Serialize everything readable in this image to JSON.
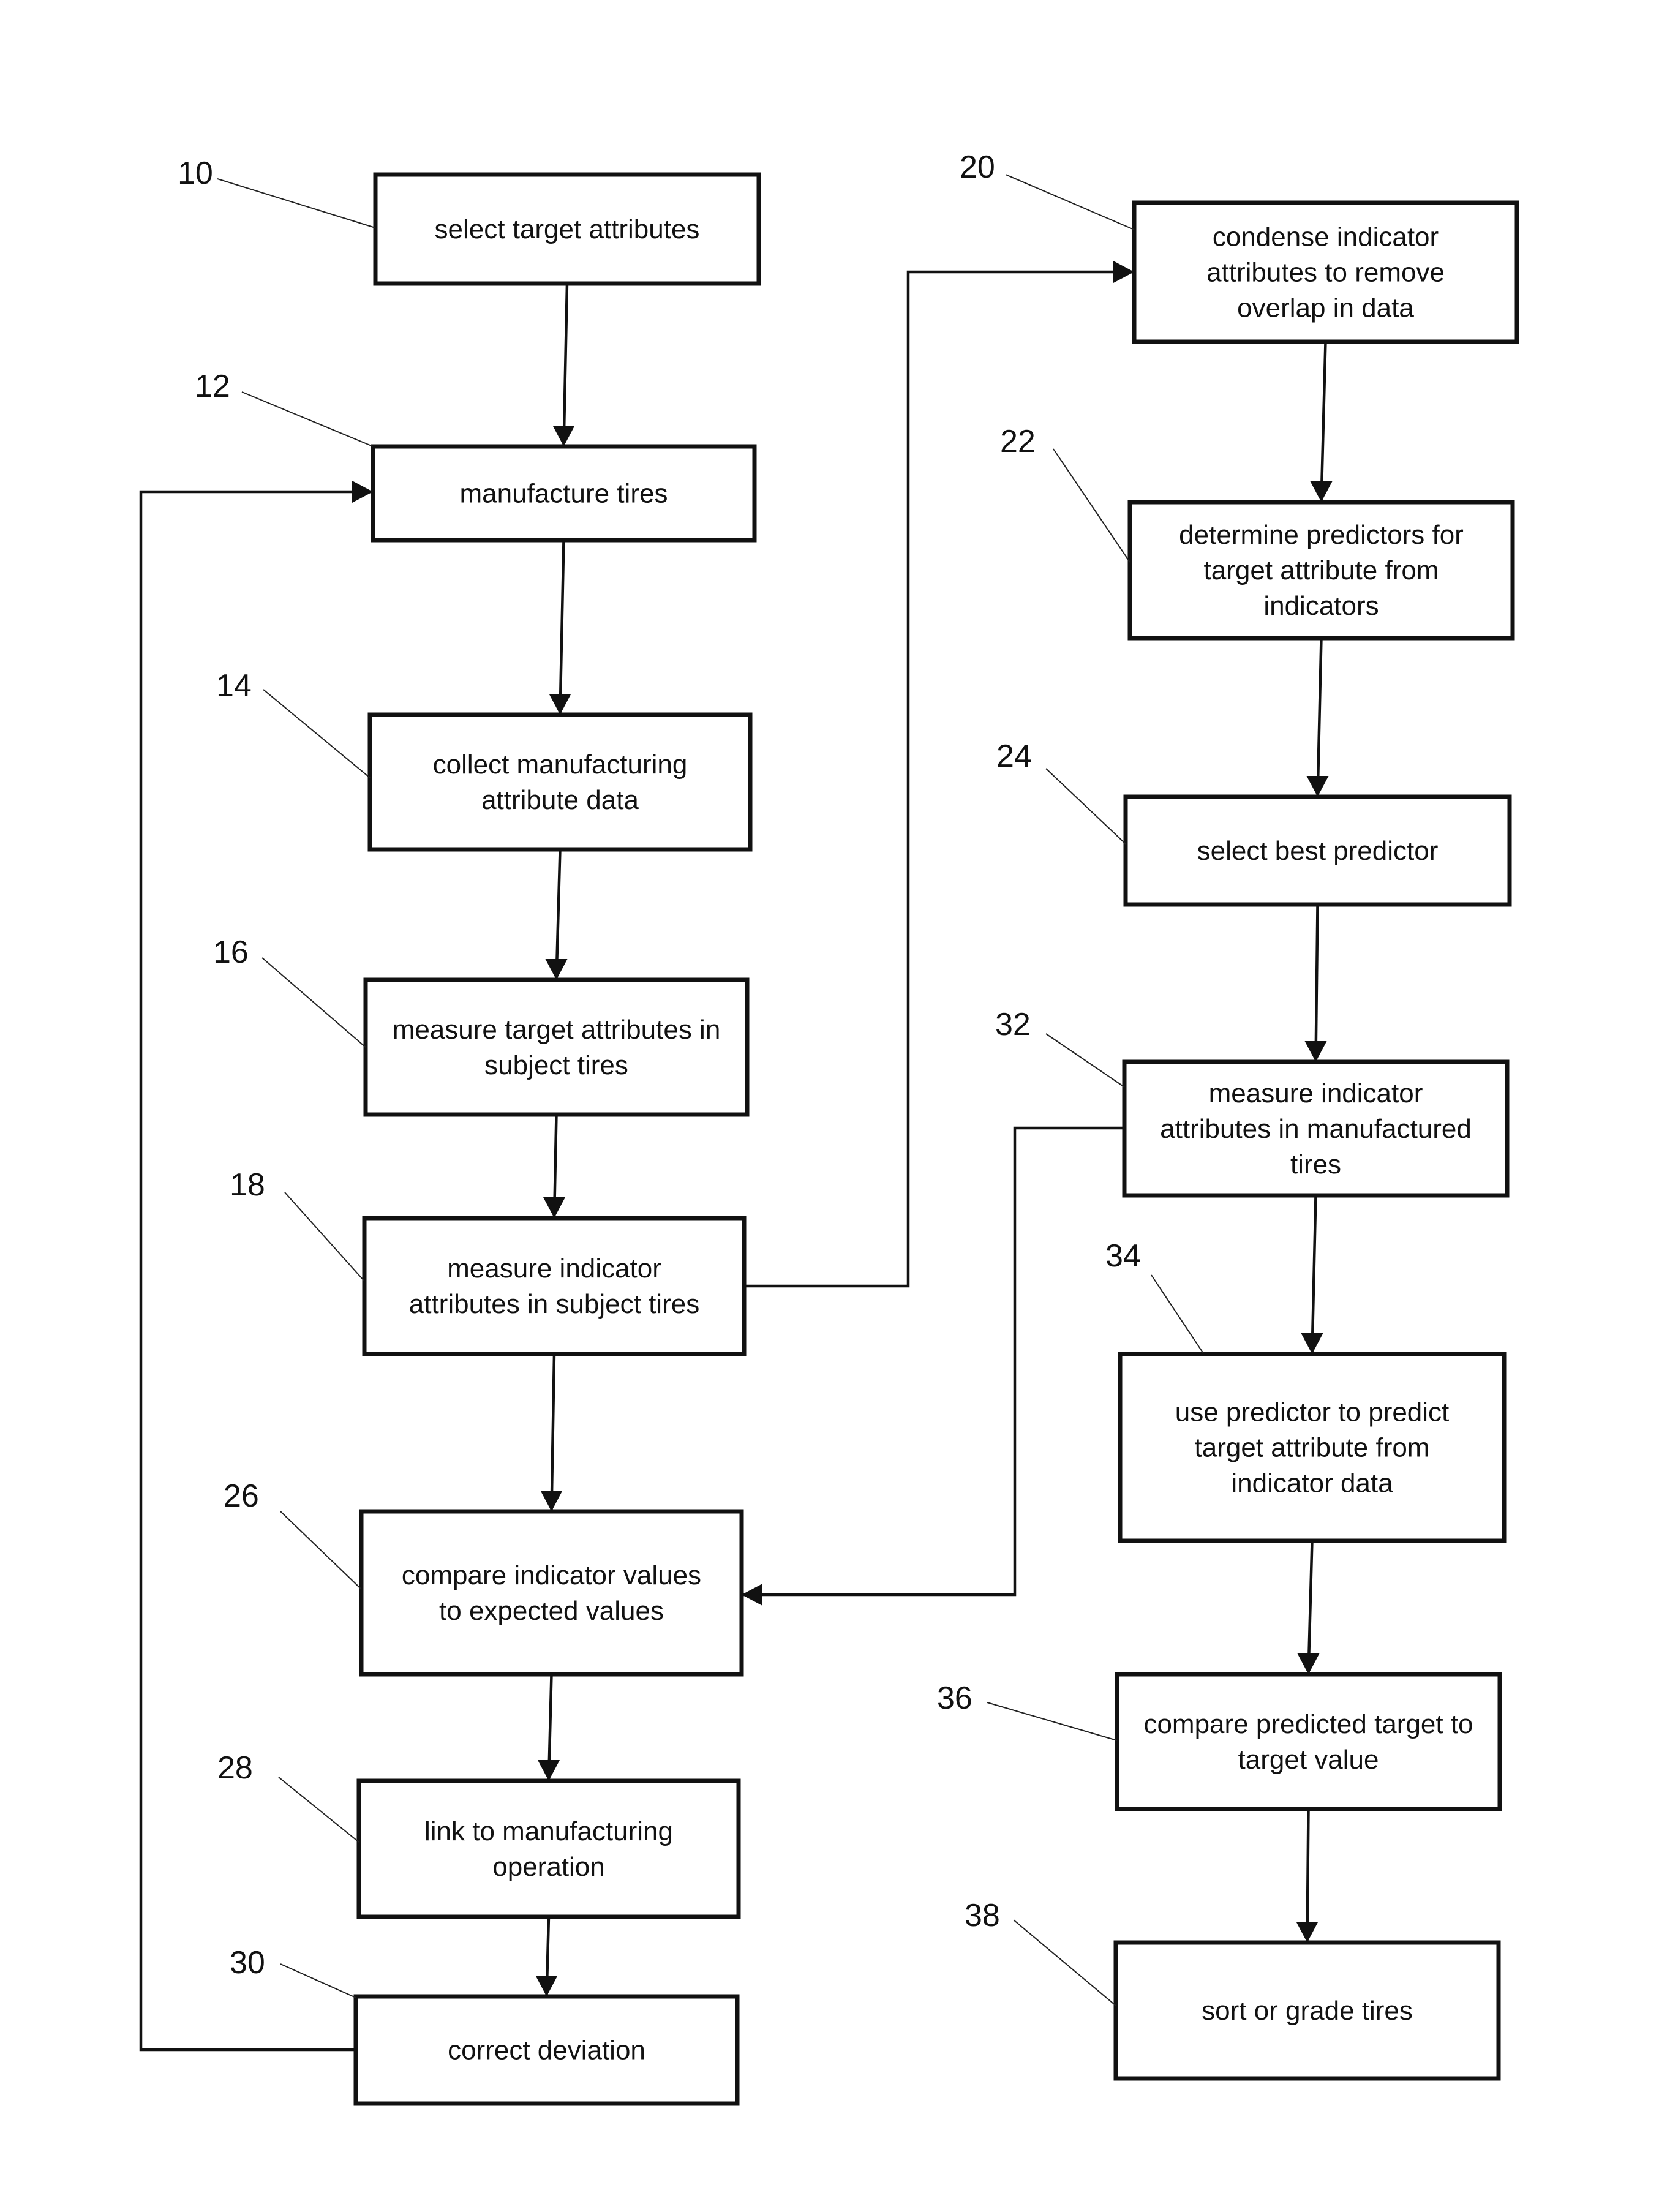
{
  "diagram": {
    "type": "flowchart",
    "nodes": [
      {
        "id": "10",
        "ref": "10",
        "lines": [
          "select target attributes"
        ]
      },
      {
        "id": "12",
        "ref": "12",
        "lines": [
          "manufacture tires"
        ]
      },
      {
        "id": "14",
        "ref": "14",
        "lines": [
          "collect manufacturing",
          "attribute data"
        ]
      },
      {
        "id": "16",
        "ref": "16",
        "lines": [
          "measure target attributes in",
          "subject tires"
        ]
      },
      {
        "id": "18",
        "ref": "18",
        "lines": [
          "measure indicator",
          "attributes in subject tires"
        ]
      },
      {
        "id": "26",
        "ref": "26",
        "lines": [
          "compare indicator values",
          "to expected values"
        ]
      },
      {
        "id": "28",
        "ref": "28",
        "lines": [
          "link to manufacturing",
          "operation"
        ]
      },
      {
        "id": "30",
        "ref": "30",
        "lines": [
          "correct deviation"
        ]
      },
      {
        "id": "20",
        "ref": "20",
        "lines": [
          "condense indicator",
          "attributes to remove",
          "overlap in data"
        ]
      },
      {
        "id": "22",
        "ref": "22",
        "lines": [
          "determine predictors for",
          "target attribute from",
          "indicators"
        ]
      },
      {
        "id": "24",
        "ref": "24",
        "lines": [
          "select best predictor"
        ]
      },
      {
        "id": "32",
        "ref": "32",
        "lines": [
          "measure indicator",
          "attributes in manufactured",
          "tires"
        ]
      },
      {
        "id": "34",
        "ref": "34",
        "lines": [
          "use predictor to predict",
          "target attribute from",
          "indicator data"
        ]
      },
      {
        "id": "36",
        "ref": "36",
        "lines": [
          "compare predicted target to",
          "target value"
        ]
      },
      {
        "id": "38",
        "ref": "38",
        "lines": [
          "sort or grade tires"
        ]
      }
    ],
    "edges": [
      {
        "from": "10",
        "to": "12"
      },
      {
        "from": "12",
        "to": "14"
      },
      {
        "from": "14",
        "to": "16"
      },
      {
        "from": "16",
        "to": "18"
      },
      {
        "from": "18",
        "to": "26"
      },
      {
        "from": "26",
        "to": "28"
      },
      {
        "from": "28",
        "to": "30"
      },
      {
        "from": "30",
        "to": "12",
        "kind": "feedback loop"
      },
      {
        "from": "18",
        "to": "20"
      },
      {
        "from": "20",
        "to": "22"
      },
      {
        "from": "22",
        "to": "24"
      },
      {
        "from": "24",
        "to": "32"
      },
      {
        "from": "32",
        "to": "34"
      },
      {
        "from": "32",
        "to": "26"
      },
      {
        "from": "34",
        "to": "36"
      },
      {
        "from": "36",
        "to": "38"
      }
    ]
  }
}
